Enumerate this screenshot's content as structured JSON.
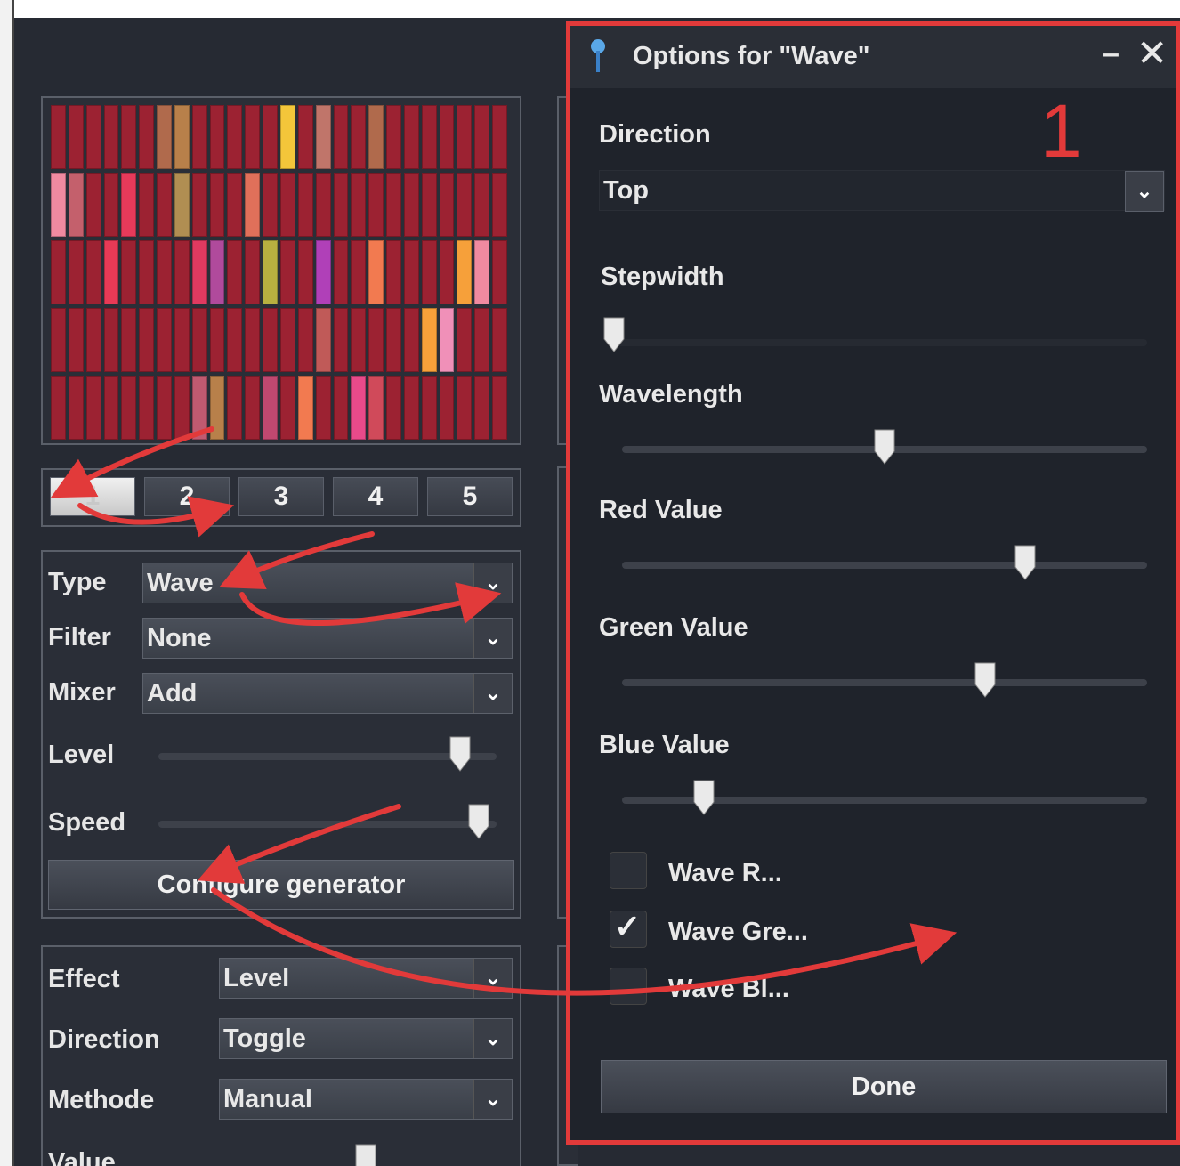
{
  "window": {
    "title": "Options for \"Wave\""
  },
  "tabs": [
    "1",
    "2",
    "3",
    "4",
    "5"
  ],
  "active_tab": 0,
  "generator": {
    "type_label": "Type",
    "type_value": "Wave",
    "filter_label": "Filter",
    "filter_value": "None",
    "mixer_label": "Mixer",
    "mixer_value": "Add",
    "level_label": "Level",
    "level_position": 0.92,
    "speed_label": "Speed",
    "speed_position": 0.98,
    "configure_label": "Configure generator"
  },
  "effect": {
    "effect_label": "Effect",
    "effect_value": "Level",
    "direction_label": "Direction",
    "direction_value": "Toggle",
    "methode_label": "Methode",
    "methode_value": "Manual",
    "value_label": "Value"
  },
  "dialog": {
    "title": "Options for \"Wave\"",
    "direction_label": "Direction",
    "direction_value": "Top",
    "stepwidth_label": "Stepwidth",
    "stepwidth_position": 0.0,
    "wavelength_label": "Wavelength",
    "wavelength_position": 0.5,
    "red_label": "Red Value",
    "red_position": 0.78,
    "green_label": "Green Value",
    "green_position": 0.7,
    "blue_label": "Blue Value",
    "blue_position": 0.14,
    "checkboxes": [
      {
        "label": "Wave R...",
        "checked": false
      },
      {
        "label": "Wave Gre...",
        "checked": true
      },
      {
        "label": "Wave Bl...",
        "checked": false
      }
    ],
    "done_label": "Done"
  },
  "annotation": {
    "number": "1"
  },
  "colors": {
    "accent_red": "#e23a3a",
    "background": "#262a33",
    "grid_base": "#9c2232"
  },
  "led_grid": {
    "rows": 5,
    "cols": 26,
    "highlights": [
      [
        0,
        6,
        "#b06a4c"
      ],
      [
        0,
        7,
        "#b8804a"
      ],
      [
        0,
        13,
        "#f3c63a"
      ],
      [
        0,
        15,
        "#c0756a"
      ],
      [
        0,
        18,
        "#b06a4c"
      ],
      [
        1,
        0,
        "#f08aa0"
      ],
      [
        1,
        1,
        "#c4606c"
      ],
      [
        1,
        4,
        "#e63a5a"
      ],
      [
        1,
        7,
        "#b08e52"
      ],
      [
        1,
        11,
        "#e0705a"
      ],
      [
        2,
        3,
        "#e83a56"
      ],
      [
        2,
        8,
        "#e03a60"
      ],
      [
        2,
        9,
        "#b04a9c"
      ],
      [
        2,
        12,
        "#b8b040"
      ],
      [
        2,
        15,
        "#b040b8"
      ],
      [
        2,
        18,
        "#f27a50"
      ],
      [
        2,
        23,
        "#f6a03a"
      ],
      [
        2,
        24,
        "#f08aa0"
      ],
      [
        3,
        15,
        "#c05a58"
      ],
      [
        3,
        21,
        "#f6a03a"
      ],
      [
        3,
        22,
        "#f090b8"
      ],
      [
        4,
        8,
        "#c05a70"
      ],
      [
        4,
        9,
        "#b8804a"
      ],
      [
        4,
        12,
        "#c04870"
      ],
      [
        4,
        14,
        "#f27a50"
      ],
      [
        4,
        17,
        "#e84a8a"
      ],
      [
        4,
        18,
        "#d04a5a"
      ]
    ]
  }
}
